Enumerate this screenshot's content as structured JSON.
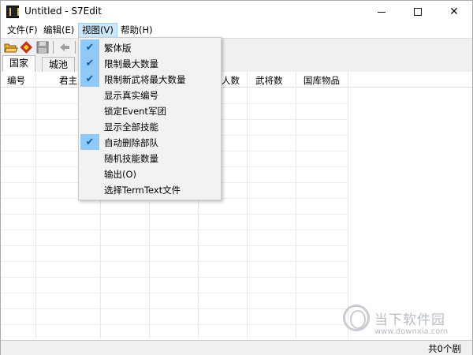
{
  "window": {
    "title": "Untitled - S7Edit",
    "icon": "app-icon"
  },
  "menubar": {
    "items": [
      {
        "label": "文件(F)"
      },
      {
        "label": "编辑(E)"
      },
      {
        "label": "视图(V)",
        "active": true
      },
      {
        "label": "帮助(H)"
      }
    ]
  },
  "toolbar": {
    "buttons": [
      "open-folder-icon",
      "edit-icon",
      "save-icon",
      "back-arrow-icon"
    ]
  },
  "tabs": [
    {
      "label": "国家",
      "active": true
    },
    {
      "label": "城池",
      "active": false
    }
  ],
  "grid": {
    "columns": [
      {
        "label": "编号"
      },
      {
        "label": "君主"
      },
      {
        "label": "人数"
      },
      {
        "label": "武将数"
      },
      {
        "label": "国库物品"
      }
    ]
  },
  "view_menu": {
    "items": [
      {
        "label": "繁体版",
        "checked": true
      },
      {
        "label": "限制最大数量",
        "checked": true
      },
      {
        "label": "限制新武将最大数量",
        "checked": true
      },
      {
        "label": "显示真实编号",
        "checked": false
      },
      {
        "label": "锁定Event军团",
        "checked": false
      },
      {
        "label": "显示全部技能",
        "checked": false
      },
      {
        "label": "自动删除部队",
        "checked": true
      },
      {
        "label": "随机技能数量",
        "checked": false
      },
      {
        "label": "输出(O)",
        "checked": false
      },
      {
        "label": "选择TermText文件",
        "checked": false
      }
    ]
  },
  "status": {
    "text": "共0个剧"
  },
  "watermark": {
    "title": "当下软件园",
    "url": "www.downxia.com"
  },
  "colors": {
    "menu_highlight": "#cce8ff",
    "check_bg": "#90c8f6",
    "check_mark": "#1060b0"
  }
}
